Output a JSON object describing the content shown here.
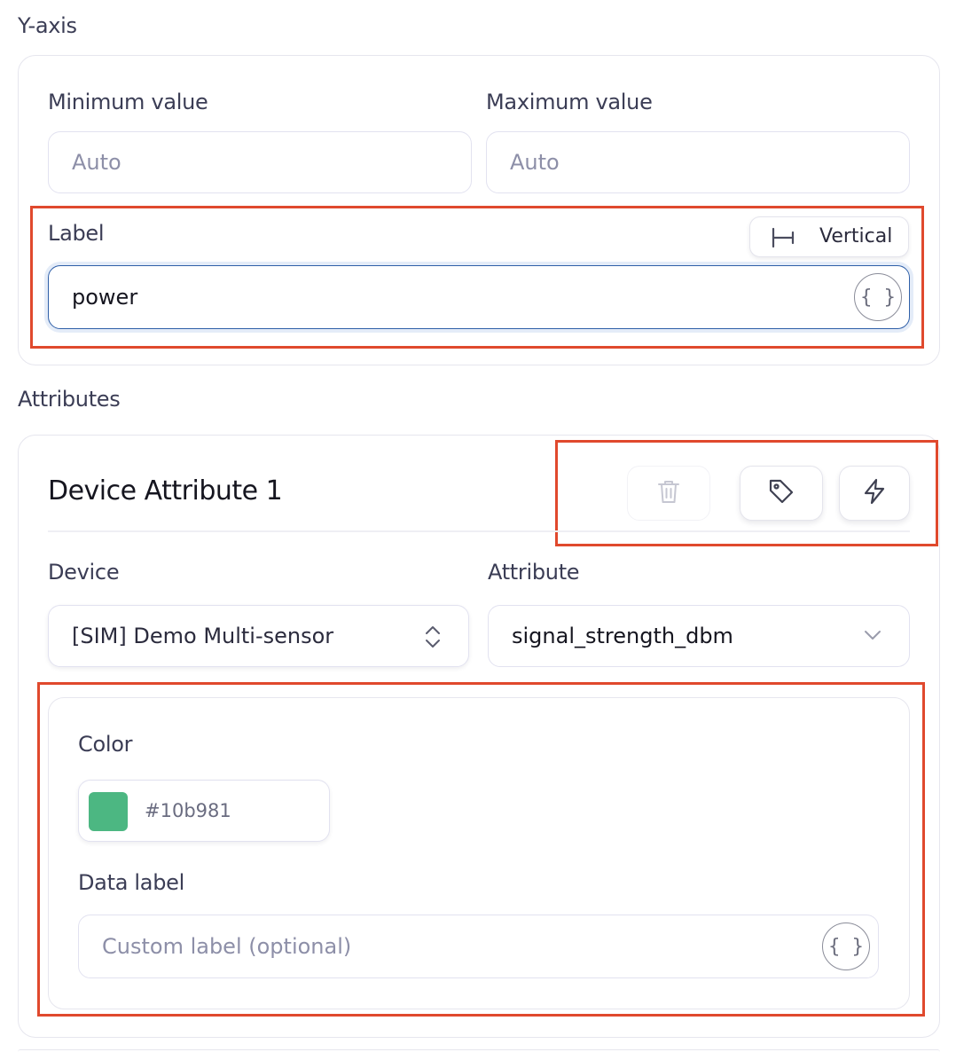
{
  "y_axis": {
    "section_title": "Y-axis",
    "minimum": {
      "label": "Minimum value",
      "placeholder": "Auto"
    },
    "maximum": {
      "label": "Maximum value",
      "placeholder": "Auto"
    },
    "label_field": {
      "label": "Label",
      "value": "power",
      "orientation_button": "Vertical",
      "variable_button": "{ }"
    }
  },
  "attributes": {
    "section_title": "Attributes",
    "attribute_card": {
      "title": "Device Attribute 1",
      "actions": [
        "delete-icon",
        "tag-icon",
        "lightning-icon"
      ],
      "device": {
        "label": "Device",
        "value": "[SIM] Demo Multi-sensor"
      },
      "attribute": {
        "label": "Attribute",
        "value": "signal_strength_dbm"
      },
      "color": {
        "label": "Color",
        "value": "#10b981",
        "swatch": "#4cb782"
      },
      "data_label": {
        "label": "Data label",
        "placeholder": "Custom label (optional)",
        "variable_button": "{ }"
      }
    }
  },
  "colors": {
    "highlight": "#e0492d",
    "focus_border": "#2f5fa8",
    "text": "#3b3d55"
  }
}
